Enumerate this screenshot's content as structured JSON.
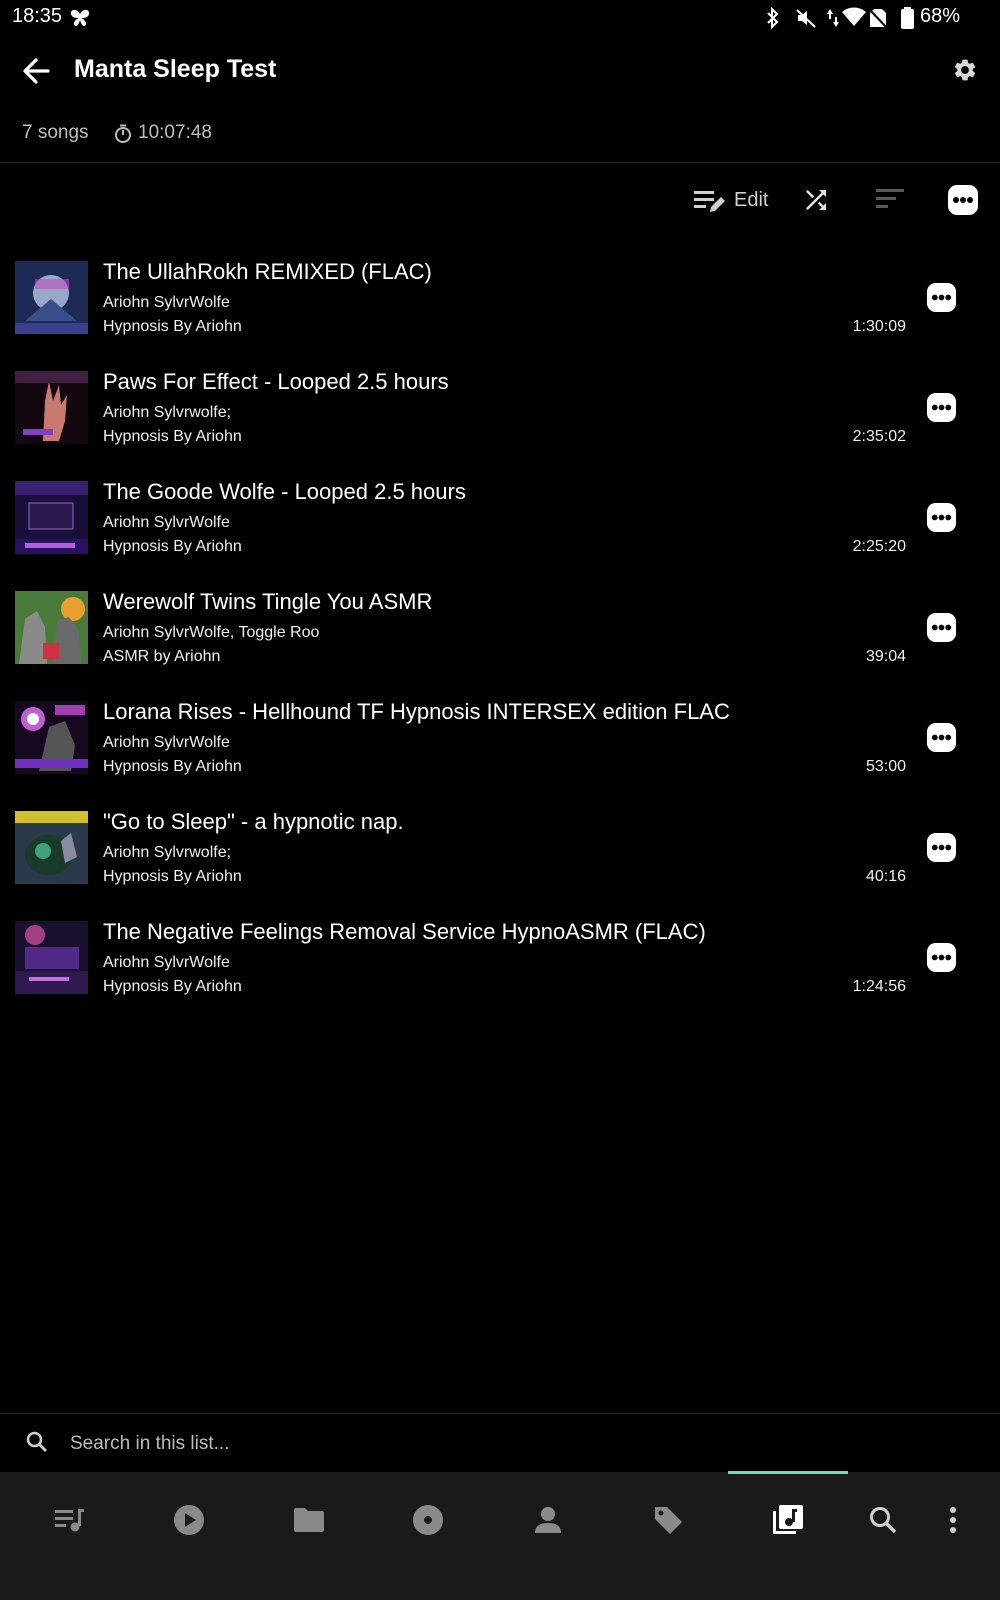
{
  "status_bar": {
    "time": "18:35",
    "battery": "68%"
  },
  "header": {
    "title": "Manta Sleep Test",
    "songs_count": "7 songs",
    "total_duration": "10:07:48"
  },
  "toolbar": {
    "edit_label": "Edit"
  },
  "songs": [
    {
      "title": "The UllahRokh REMIXED (FLAC)",
      "artist": "Ariohn SylvrWolfe",
      "album": "Hypnosis By Ariohn",
      "duration": "1:30:09"
    },
    {
      "title": "Paws For Effect - Looped 2.5 hours",
      "artist": "Ariohn Sylvrwolfe;",
      "album": "Hypnosis By Ariohn",
      "duration": "2:35:02"
    },
    {
      "title": "The Goode Wolfe - Looped 2.5 hours",
      "artist": "Ariohn SylvrWolfe",
      "album": "Hypnosis By Ariohn",
      "duration": "2:25:20"
    },
    {
      "title": "Werewolf Twins Tingle You ASMR",
      "artist": "Ariohn SylvrWolfe, Toggle Roo",
      "album": "ASMR by Ariohn",
      "duration": "39:04"
    },
    {
      "title": "Lorana Rises - Hellhound TF Hypnosis INTERSEX edition FLAC",
      "artist": "Ariohn SylvrWolfe",
      "album": "Hypnosis By Ariohn",
      "duration": "53:00"
    },
    {
      "title": "\"Go to Sleep\" - a hypnotic nap.",
      "artist": "Ariohn Sylvrwolfe;",
      "album": "Hypnosis By Ariohn",
      "duration": "40:16"
    },
    {
      "title": "The Negative Feelings Removal Service HypnoASMR (FLAC)",
      "artist": "Ariohn SylvrWolfe",
      "album": "Hypnosis By Ariohn",
      "duration": "1:24:56"
    }
  ],
  "search": {
    "placeholder": "Search in this list..."
  },
  "bottom_nav": {
    "items": [
      "queue-icon",
      "play-icon",
      "folder-icon",
      "album-icon",
      "artist-icon",
      "tag-icon",
      "playlist-icon",
      "search-icon",
      "more-vert-icon"
    ],
    "active": "playlist-icon",
    "accent_color": "#6be0b0"
  }
}
